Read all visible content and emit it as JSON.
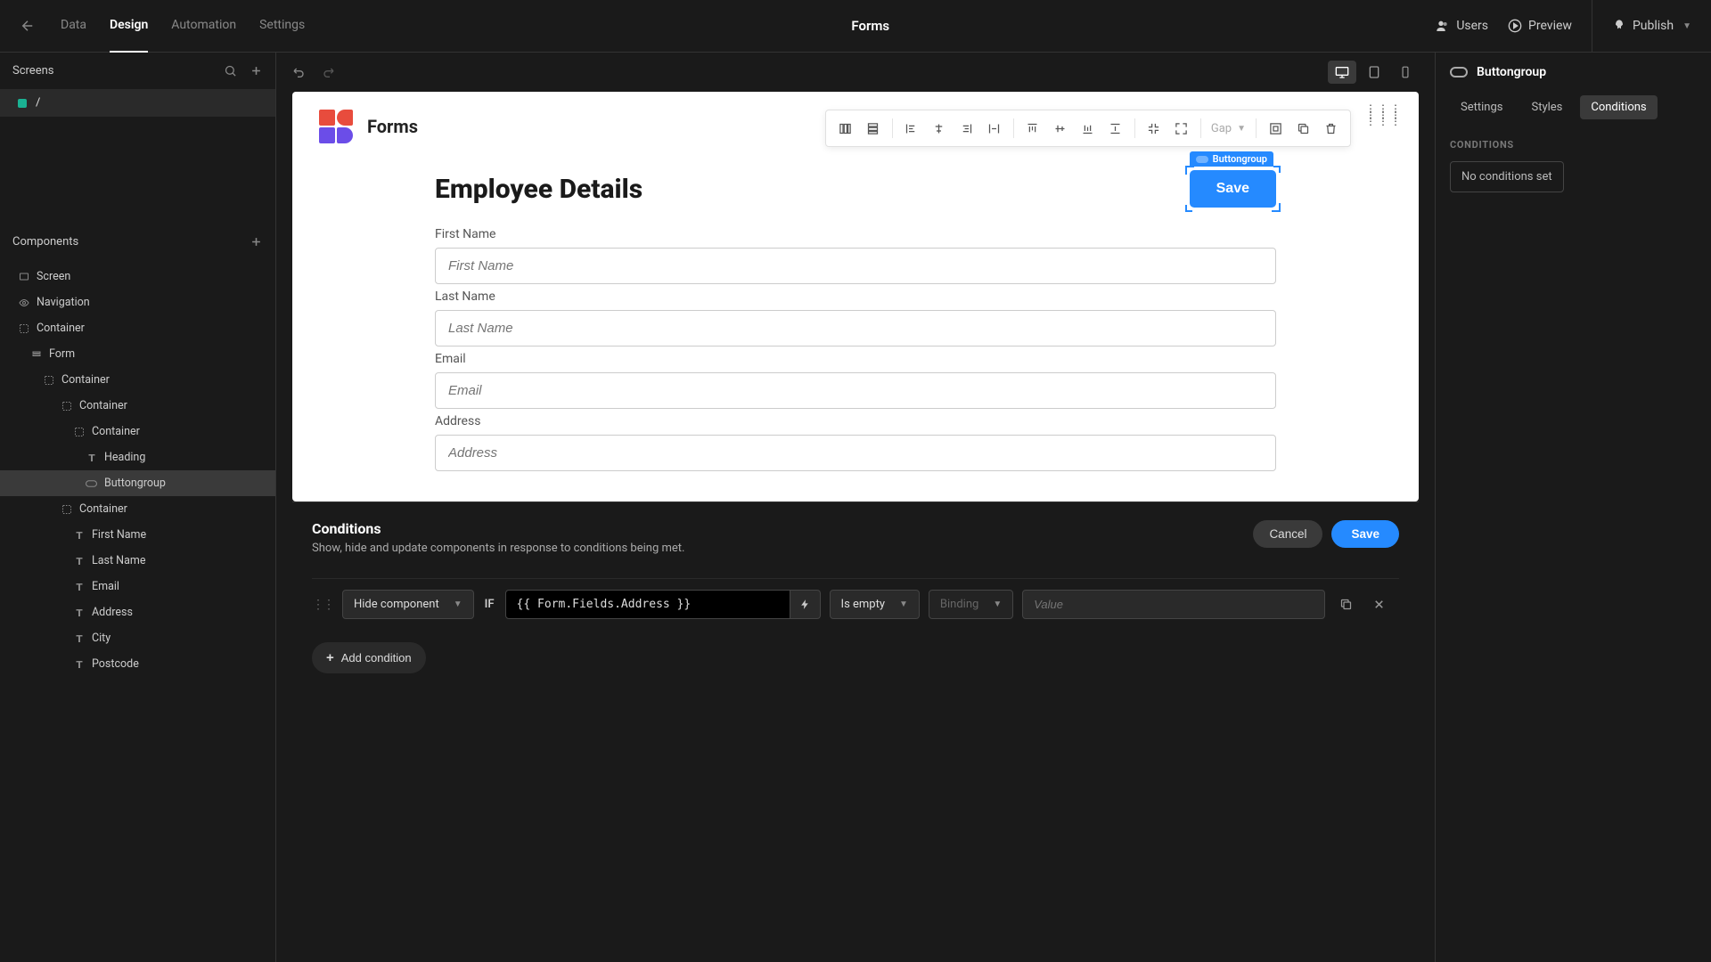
{
  "topbar": {
    "tabs": {
      "data": "Data",
      "design": "Design",
      "automation": "Automation",
      "settings": "Settings"
    },
    "title": "Forms",
    "actions": {
      "users": "Users",
      "preview": "Preview",
      "publish": "Publish"
    }
  },
  "leftPanel": {
    "screensHeader": "Screens",
    "screenName": "/",
    "componentsHeader": "Components",
    "tree": {
      "screen": "Screen",
      "navigation": "Navigation",
      "container": "Container",
      "form": "Form",
      "containerA": "Container",
      "containerB": "Container",
      "containerC": "Container",
      "heading": "Heading",
      "buttongroup": "Buttongroup",
      "containerD": "Container",
      "firstName": "First Name",
      "lastName": "Last Name",
      "email": "Email",
      "address": "Address",
      "city": "City",
      "postcode": "Postcode"
    }
  },
  "canvas": {
    "appTitle": "Forms",
    "floatingToolbar": {
      "gap": "Gap"
    },
    "selectionBadge": "Buttongroup",
    "form": {
      "heading": "Employee Details",
      "saveBtn": "Save",
      "fields": [
        {
          "label": "First Name",
          "placeholder": "First Name"
        },
        {
          "label": "Last Name",
          "placeholder": "Last Name"
        },
        {
          "label": "Email",
          "placeholder": "Email"
        },
        {
          "label": "Address",
          "placeholder": "Address"
        }
      ]
    }
  },
  "condPanel": {
    "title": "Conditions",
    "subtitle": "Show, hide and update components in response to conditions being met.",
    "cancel": "Cancel",
    "save": "Save",
    "row": {
      "action": "Hide component",
      "ifLabel": "IF",
      "binding": "{{ Form.Fields.Address }}",
      "operator": "Is empty",
      "bindingDisabled": "Binding",
      "valuePlaceholder": "Value"
    },
    "addCondition": "Add condition"
  },
  "rightPanel": {
    "title": "Buttongroup",
    "tabs": {
      "settings": "Settings",
      "styles": "Styles",
      "conditions": "Conditions"
    },
    "sectionLabel": "CONDITIONS",
    "noConditions": "No conditions set"
  }
}
